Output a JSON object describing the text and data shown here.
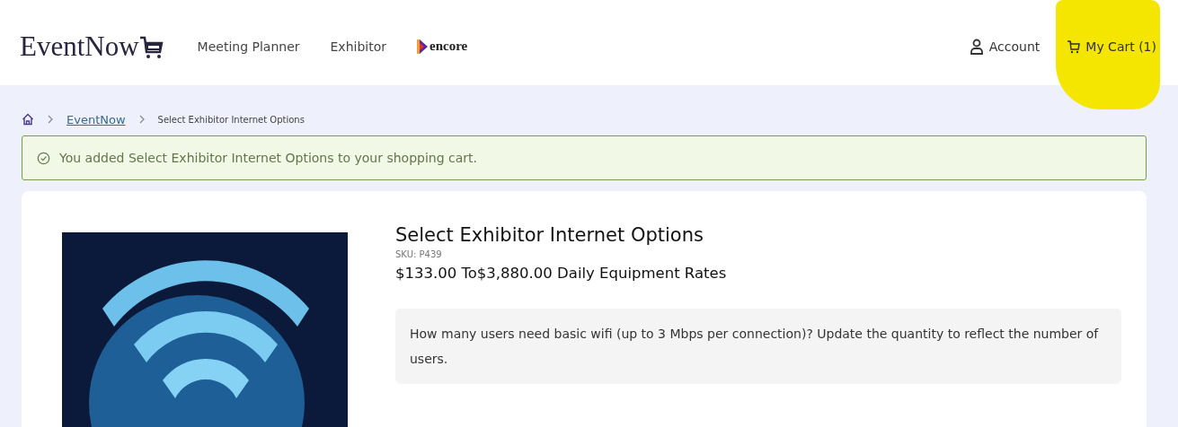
{
  "header": {
    "logo": "EventNow",
    "nav": [
      {
        "label": "Meeting Planner"
      },
      {
        "label": "Exhibitor"
      }
    ],
    "partner_logo": "encore",
    "account": "Account",
    "cart": "My Cart (1)",
    "cart_highlighted": true
  },
  "breadcrumb": {
    "items": [
      {
        "label": "EventNow",
        "kind": "link"
      },
      {
        "label": "Select Exhibitor Internet Options",
        "kind": "current"
      }
    ]
  },
  "alert": {
    "message": "You added Select Exhibitor Internet Options to your shopping cart."
  },
  "product": {
    "title": "Select Exhibitor Internet Options",
    "sku": "SKU: P439",
    "price": "$133.00 To$3,880.00 Daily Equipment Rates",
    "question": "How many users need basic wifi (up to 3 Mbps per connection)?  Update the quantity to reflect the number of users."
  }
}
